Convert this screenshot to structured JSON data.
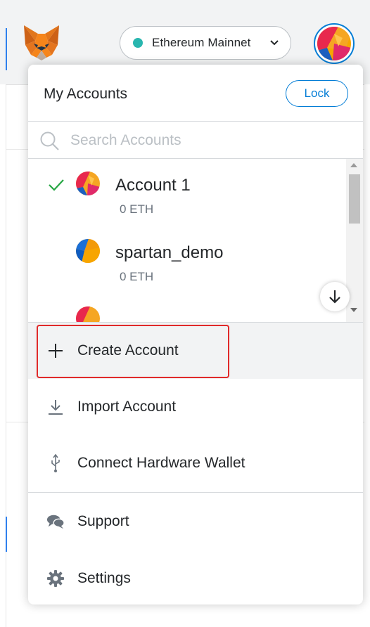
{
  "network": {
    "label": "Ethereum Mainnet",
    "dot_color": "#29b6af"
  },
  "menu": {
    "title": "My Accounts",
    "lock_label": "Lock",
    "search_placeholder": "Search Accounts",
    "accounts": [
      {
        "name": "Account 1",
        "balance": "0 ETH",
        "selected": true
      },
      {
        "name": "spartan_demo",
        "balance": "0 ETH",
        "selected": false
      }
    ],
    "items": [
      {
        "label": "Create Account",
        "icon": "plus-icon"
      },
      {
        "label": "Import Account",
        "icon": "import-icon"
      },
      {
        "label": "Connect Hardware Wallet",
        "icon": "usb-icon"
      },
      {
        "label": "Support",
        "icon": "chat-icon"
      },
      {
        "label": "Settings",
        "icon": "gear-icon"
      }
    ]
  },
  "colors": {
    "accent": "#037dd6",
    "highlight": "#e02a2a",
    "check": "#28a745"
  }
}
